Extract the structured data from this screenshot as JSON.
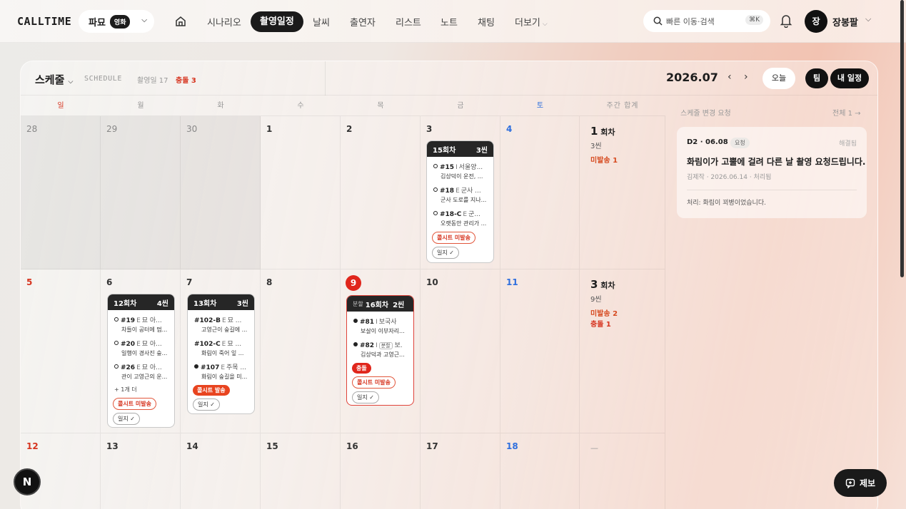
{
  "app": {
    "brand": "CALLTIME",
    "project": "파묘",
    "project_tag": "영화"
  },
  "nav": {
    "items": [
      "시나리오",
      "촬영일정",
      "날씨",
      "출연자",
      "리스트",
      "노트",
      "채팅",
      "더보기"
    ],
    "active": "촬영일정"
  },
  "search": {
    "placeholder": "빠른 이동·검색",
    "shortcut": "⌘K"
  },
  "user": {
    "avatar": "장",
    "name": "장봉팔"
  },
  "schedule": {
    "title": "스케줄",
    "subtitle": "SCHEDULE",
    "shoot_days": "촬영일 17",
    "conflicts": "충돌 3",
    "month": "2026.07",
    "today_btn": "오늘",
    "team_btn": "팀",
    "mine_btn": "내 일정"
  },
  "weekdays": [
    "일",
    "월",
    "화",
    "수",
    "목",
    "금",
    "토",
    "주간 합계"
  ],
  "weeks": [
    {
      "days": [
        "28",
        "29",
        "30",
        "1",
        "2",
        "3",
        "4"
      ],
      "summary": {
        "rounds": "1",
        "rounds_unit": "회차",
        "scenes": "3씬",
        "line1": "미발송 1",
        "line2": ""
      }
    },
    {
      "days": [
        "5",
        "6",
        "7",
        "8",
        "9",
        "10",
        "11"
      ],
      "summary": {
        "rounds": "3",
        "rounds_unit": "회차",
        "scenes": "9씬",
        "line1": "미발송 2",
        "line2": "충돌 1"
      }
    },
    {
      "days": [
        "12",
        "13",
        "14",
        "15",
        "16",
        "17",
        "18"
      ],
      "summary": {
        "placeholder": "—"
      }
    }
  ],
  "cards": {
    "jul3": {
      "round": "15회차",
      "scenes": "3씬",
      "items": [
        {
          "num": "#15",
          "ie": "I",
          "loc": "서울양...",
          "desc": "김상덕이 운전, ..."
        },
        {
          "num": "#18",
          "ie": "E",
          "loc": "군사 ...",
          "desc": "군사 도로를 지나..."
        },
        {
          "num": "#18-C",
          "ie": "E",
          "loc": "군...",
          "desc": "오랫동안 관리가 ..."
        }
      ],
      "badge1": "콜시트 미발송",
      "badge2": "일지 ✓"
    },
    "jul6": {
      "round": "12회차",
      "scenes": "4씬",
      "items": [
        {
          "num": "#19",
          "ie": "E",
          "loc": "묘 아...",
          "desc": "차들이 공터에 멈..."
        },
        {
          "num": "#20",
          "ie": "E",
          "loc": "묘 아...",
          "desc": "일행이 경사진 숲..."
        },
        {
          "num": "#26",
          "ie": "E",
          "loc": "묘 아...",
          "desc": "관이 고영근의 운..."
        }
      ],
      "more": "+ 1개 더",
      "badge1": "콜시트 미발송",
      "badge2": "일지 ✓"
    },
    "jul7": {
      "round": "13회차",
      "scenes": "3씬",
      "items": [
        {
          "num": "#102-B",
          "ie": "E",
          "loc": "묘 ...",
          "desc": "고영근이 숲길에 ..."
        },
        {
          "num": "#102-C",
          "ie": "E",
          "loc": "묘 ...",
          "desc": "화림이 죽어 잎 ..."
        },
        {
          "num": "#107",
          "ie": "E",
          "loc": "주목 ...",
          "desc": "화림이 숲길을 미..."
        }
      ],
      "badge1": "콜시트 발송",
      "badge2": "일지 ✓"
    },
    "jul9": {
      "split": "분할",
      "round": "16회차",
      "scenes": "2씬",
      "items": [
        {
          "num": "#81",
          "ie": "I",
          "loc": "보국사",
          "desc": "보살이 이부자리..."
        },
        {
          "num": "#82",
          "ie": "I",
          "chip": "분할",
          "loc": "보.",
          "desc": "김상덕과 고영근..."
        }
      ],
      "badge0": "충돌",
      "badge1": "콜시트 미발송",
      "badge2": "일지 ✓"
    }
  },
  "requests": {
    "heading": "스케줄 변경 요청",
    "all": "전체 1 →",
    "item": {
      "meta": "D2 · 06.08",
      "pill": "요청",
      "state": "해결됨",
      "title": "화림이가 고뿔에 걸려 다른 날 촬영 요청드립니다.",
      "who": "김제작 · 2026.06.14 · 처리됨",
      "resolution": "처리: 화림이 꾀병이었습니다."
    }
  },
  "floating": {
    "n": "N",
    "report": "제보"
  },
  "colors": {
    "accent": "#e0261c",
    "dark": "#1a1a1a",
    "sunday": "#d6341f",
    "saturday": "#2f6fde"
  }
}
